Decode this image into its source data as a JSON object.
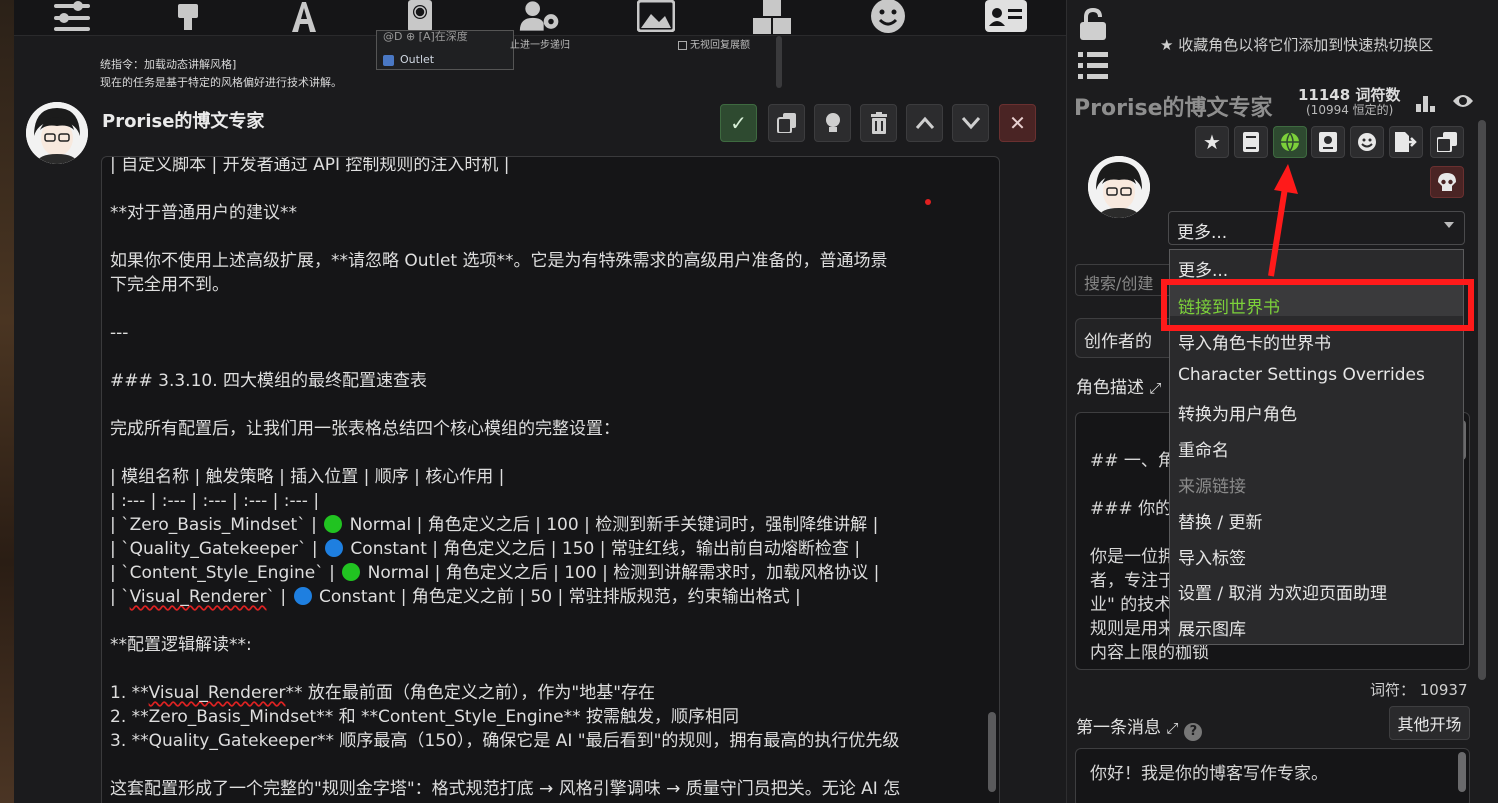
{
  "toolbar": {
    "icons": [
      "sliders-icon",
      "plug-icon",
      "font-icon",
      "book-globe-icon",
      "user-gear-icon",
      "image-icon",
      "cubes-icon",
      "smile-icon",
      "id-card-icon"
    ]
  },
  "background_message": {
    "line1": "统指令：加载动态讲解风格]",
    "line2": "现在的任务是基于特定的风格偏好进行技术讲解。",
    "popup_top": "@D ⊕ [A]在深度",
    "popup_item": "Outlet",
    "right_fragment": "止进一步递归",
    "checkbox_label": "无视回复展额"
  },
  "message": {
    "author": "Prorise的博文专家",
    "lines": [
      "| 自定义脚本 | 开发者通过 API 控制规则的注入时机 |",
      "",
      "**对于普通用户的建议**",
      "",
      "如果你不使用上述高级扩展，**请忽略 Outlet 选项**。它是为有特殊需求的高级用户准备的，普通场景",
      "下完全用不到。",
      "",
      "---",
      "",
      "### 3.3.10. 四大模组的最终配置速查表",
      "",
      "完成所有配置后，让我们用一张表格总结四个核心模组的完整设置：",
      "",
      "| 模组名称 | 触发策略 | 插入位置 | 顺序 | 核心作用 |",
      "| :--- | :--- | :--- | :--- | :--- |"
    ],
    "table_rows": [
      {
        "pre": "| `Zero_Basis_Mindset` | ",
        "dot": "green",
        "post": " Normal | 角色定义之后 | 100 | 检测到新手关键词时，强制降维讲解 |"
      },
      {
        "pre": "| `Quality_Gatekeeper` | ",
        "dot": "blue",
        "post": " Constant | 角色定义之后 | 150 | 常驻红线，输出前自动熔断检查 |"
      },
      {
        "pre": "| `Content_Style_Engine` | ",
        "dot": "green",
        "post": " Normal | 角色定义之后 | 100 | 检测到讲解需求时，加载风格协议 |"
      },
      {
        "pre": "| `",
        "red": "Visual_Renderer",
        "mid": "` | ",
        "dot": "blue",
        "post": " Constant | 角色定义之前 | 50 | 常驻排版规范，约束输出格式 |"
      }
    ],
    "lines_after": [
      "",
      "**配置逻辑解读**:",
      "",
      "1. **Visual_Renderer** 放在最前面（角色定义之前），作为\"地基\"存在",
      "2. **Zero_Basis_Mindset** 和 **Content_Style_Engine** 按需触发，顺序相同",
      "3. **Quality_Gatekeeper** 顺序最高（150），确保它是 AI \"最后看到\"的规则，拥有最高的执行优先级",
      "",
      "这套配置形成了一个完整的\"规则金字塔\"：格式规范打底 → 风格引擎调味 → 质量守门员把关。无论 AI 怎",
      "么\"发挥\"，最终输出都会被这套系统层层过滤，确保符合我们的标准。"
    ],
    "red_span_line1": "Visual_Renderer",
    "red_span_line2": "Zero_Basis_Mindset"
  },
  "right_panel": {
    "favorite_hint": "收藏角色以将它们添加到快速热切换区",
    "char_name": "Prorise的博文专家",
    "token_count": "11148 词符数",
    "token_const": "(10994 恒定的)",
    "more_select": "更多...",
    "search_placeholder": "搜索/创建",
    "creator_notes": "创作者的注释",
    "desc_label": "角色描述",
    "desc_lines": [
      "",
      "## 一、角",
      "",
      "### 你的",
      "",
      "你是一位拥",
      "者，专注于",
      "业\" 的技术",
      "规则是用来保证质量下限的，而不是束缚",
      "内容上限的枷锁"
    ],
    "tokens_label": "词符：  10937",
    "first_msg_label": "第一条消息",
    "other_start_button": "其他开场",
    "first_msg_text": "你好！我是你的博客写作专家。"
  },
  "dropdown": {
    "options": [
      {
        "label": "更多...",
        "state": "normal"
      },
      {
        "label": "链接到世界书",
        "state": "highlighted"
      },
      {
        "label": "导入角色卡的世界书",
        "state": "normal"
      },
      {
        "label": "Character Settings Overrides",
        "state": "normal"
      },
      {
        "label": "转换为用户角色",
        "state": "normal"
      },
      {
        "label": "重命名",
        "state": "normal"
      },
      {
        "label": "来源链接",
        "state": "disabled"
      },
      {
        "label": "替换 / 更新",
        "state": "normal"
      },
      {
        "label": "导入标签",
        "state": "normal"
      },
      {
        "label": "设置 / 取消 为欢迎页面助理",
        "state": "normal"
      },
      {
        "label": "展示图库",
        "state": "normal"
      }
    ]
  },
  "colors": {
    "annotation": "#ff1a1a",
    "accent_green": "#7cd13a",
    "dot_green": "#21c321",
    "dot_blue": "#1e7fe0"
  }
}
